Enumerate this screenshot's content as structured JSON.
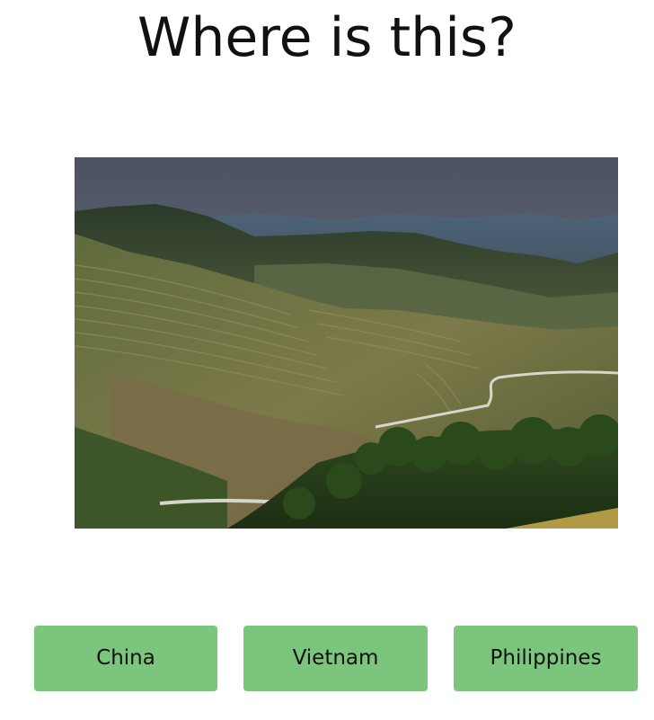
{
  "quiz": {
    "question": "Where is this?",
    "image": {
      "subject": "terraced-hills-landscape",
      "alt": ""
    },
    "answers": [
      {
        "label": "China"
      },
      {
        "label": "Vietnam"
      },
      {
        "label": "Philippines"
      }
    ]
  },
  "colors": {
    "button_bg": "#7bc67c",
    "title_text": "#111111",
    "page_bg": "#ffffff"
  }
}
